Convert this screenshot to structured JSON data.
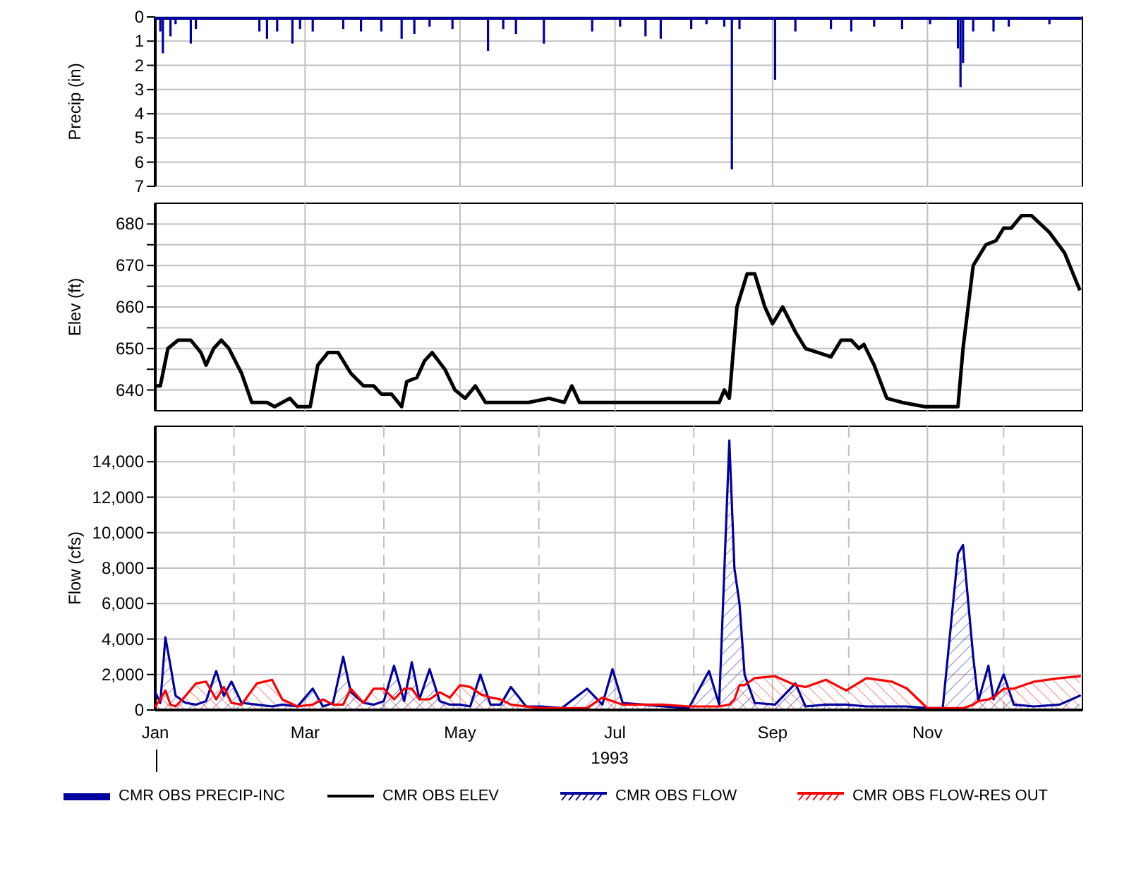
{
  "panels": [
    {
      "chart_data": {
        "type": "bar",
        "ylabel": "Precip (in)",
        "grid": true,
        "xlim": [
          "1993-01-01",
          "1994-01-01"
        ],
        "ylim": [
          7,
          0
        ],
        "yticks": [
          0,
          1,
          2,
          3,
          4,
          5,
          6,
          7
        ],
        "x": [
          "1993-01-03",
          "1993-01-04",
          "1993-01-07",
          "1993-01-09",
          "1993-01-15",
          "1993-01-17",
          "1993-02-11",
          "1993-02-14",
          "1993-02-18",
          "1993-02-24",
          "1993-02-27",
          "1993-03-04",
          "1993-03-16",
          "1993-03-23",
          "1993-03-31",
          "1993-04-08",
          "1993-04-13",
          "1993-04-19",
          "1993-04-28",
          "1993-05-12",
          "1993-05-18",
          "1993-05-23",
          "1993-06-03",
          "1993-06-22",
          "1993-07-03",
          "1993-07-13",
          "1993-07-19",
          "1993-07-31",
          "1993-08-06",
          "1993-08-13",
          "1993-08-16",
          "1993-08-19",
          "1993-09-02",
          "1993-09-10",
          "1993-09-24",
          "1993-10-02",
          "1993-10-11",
          "1993-10-22",
          "1993-11-02",
          "1993-11-13",
          "1993-11-14",
          "1993-11-15",
          "1993-11-19",
          "1993-11-27",
          "1993-12-03",
          "1993-12-19"
        ],
        "series": [
          {
            "name": "CMR OBS PRECIP-INC",
            "color": "#0000a0",
            "values": [
              0.6,
              1.5,
              0.8,
              0.3,
              1.1,
              0.5,
              0.6,
              0.9,
              0.6,
              1.1,
              0.5,
              0.6,
              0.5,
              0.6,
              0.6,
              0.9,
              0.7,
              0.4,
              0.5,
              1.4,
              0.5,
              0.7,
              1.1,
              0.6,
              0.4,
              0.8,
              0.9,
              0.5,
              0.3,
              0.4,
              6.3,
              0.5,
              2.6,
              0.6,
              0.5,
              0.6,
              0.4,
              0.5,
              0.3,
              1.3,
              2.9,
              1.9,
              0.6,
              0.6,
              0.4,
              0.3
            ]
          }
        ]
      }
    },
    {
      "chart_data": {
        "type": "line",
        "ylabel": "Elev (ft)",
        "grid": true,
        "xlim": [
          "1993-01-01",
          "1994-01-01"
        ],
        "ylim": [
          635,
          685
        ],
        "yticks": [
          640,
          650,
          660,
          670,
          680
        ],
        "x": [
          "1993-01-01",
          "1993-01-03",
          "1993-01-06",
          "1993-01-10",
          "1993-01-15",
          "1993-01-19",
          "1993-01-21",
          "1993-01-24",
          "1993-01-27",
          "1993-01-30",
          "1993-02-04",
          "1993-02-08",
          "1993-02-14",
          "1993-02-17",
          "1993-02-23",
          "1993-02-26",
          "1993-03-03",
          "1993-03-06",
          "1993-03-10",
          "1993-03-14",
          "1993-03-19",
          "1993-03-24",
          "1993-03-28",
          "1993-03-31",
          "1993-04-04",
          "1993-04-08",
          "1993-04-10",
          "1993-04-14",
          "1993-04-17",
          "1993-04-20",
          "1993-04-25",
          "1993-04-29",
          "1993-05-03",
          "1993-05-07",
          "1993-05-11",
          "1993-05-19",
          "1993-05-28",
          "1993-06-05",
          "1993-06-11",
          "1993-06-14",
          "1993-06-17",
          "1993-06-27",
          "1993-07-14",
          "1993-08-11",
          "1993-08-13",
          "1993-08-15",
          "1993-08-18",
          "1993-08-22",
          "1993-08-25",
          "1993-08-29",
          "1993-09-01",
          "1993-09-05",
          "1993-09-10",
          "1993-09-14",
          "1993-09-19",
          "1993-09-24",
          "1993-09-28",
          "1993-10-02",
          "1993-10-05",
          "1993-10-07",
          "1993-10-11",
          "1993-10-16",
          "1993-10-22",
          "1993-10-31",
          "1993-11-13",
          "1993-11-15",
          "1993-11-19",
          "1993-11-24",
          "1993-11-28",
          "1993-12-01",
          "1993-12-04",
          "1993-12-08",
          "1993-12-12",
          "1993-12-19",
          "1993-12-25",
          "1993-12-31"
        ],
        "series": [
          {
            "name": "CMR OBS ELEV",
            "color": "#000000",
            "values": [
              641,
              641,
              650,
              652,
              652,
              649,
              646,
              650,
              652,
              650,
              644,
              637,
              637,
              636,
              638,
              636,
              636,
              646,
              649,
              649,
              644,
              641,
              641,
              639,
              639,
              636,
              642,
              643,
              647,
              649,
              645,
              640,
              638,
              641,
              637,
              637,
              637,
              638,
              637,
              641,
              637,
              637,
              637,
              637,
              640,
              638,
              660,
              668,
              668,
              660,
              656,
              660,
              654,
              650,
              649,
              648,
              652,
              652,
              650,
              651,
              646,
              638,
              637,
              636,
              636,
              650,
              670,
              675,
              676,
              679,
              679,
              682,
              682,
              678,
              673,
              664
            ]
          }
        ]
      }
    },
    {
      "chart_data": {
        "type": "area",
        "ylabel": "Flow (cfs)",
        "grid": true,
        "xlabel": "1993",
        "xlim": [
          "1993-01-01",
          "1994-01-01"
        ],
        "ylim": [
          0,
          16000
        ],
        "yticks": [
          {
            "value": 0,
            "label": "0"
          },
          {
            "value": 2000,
            "label": "2,000"
          },
          {
            "value": 4000,
            "label": "4,000"
          },
          {
            "value": 6000,
            "label": "6,000"
          },
          {
            "value": 8000,
            "label": "8,000"
          },
          {
            "value": 10000,
            "label": "10,000"
          },
          {
            "value": 12000,
            "label": "12,000"
          },
          {
            "value": 14000,
            "label": "14,000"
          }
        ],
        "xticks": [
          {
            "value": "1993-01-01",
            "label": "Jan"
          },
          {
            "value": "1993-03-01",
            "label": "Mar"
          },
          {
            "value": "1993-05-01",
            "label": "May"
          },
          {
            "value": "1993-07-01",
            "label": "Jul"
          },
          {
            "value": "1993-09-01",
            "label": "Sep"
          },
          {
            "value": "1993-11-01",
            "label": "Nov"
          }
        ],
        "x": [
          "1993-01-01",
          "1993-01-03",
          "1993-01-05",
          "1993-01-07",
          "1993-01-09",
          "1993-01-13",
          "1993-01-17",
          "1993-01-21",
          "1993-01-25",
          "1993-01-28",
          "1993-01-31",
          "1993-02-04",
          "1993-02-10",
          "1993-02-16",
          "1993-02-20",
          "1993-02-26",
          "1993-03-04",
          "1993-03-08",
          "1993-03-12",
          "1993-03-16",
          "1993-03-19",
          "1993-03-24",
          "1993-03-28",
          "1993-04-01",
          "1993-04-05",
          "1993-04-09",
          "1993-04-12",
          "1993-04-15",
          "1993-04-19",
          "1993-04-23",
          "1993-04-27",
          "1993-05-01",
          "1993-05-05",
          "1993-05-09",
          "1993-05-13",
          "1993-05-17",
          "1993-05-21",
          "1993-05-27",
          "1993-06-02",
          "1993-06-10",
          "1993-06-20",
          "1993-06-26",
          "1993-06-30",
          "1993-07-04",
          "1993-07-12",
          "1993-07-20",
          "1993-07-30",
          "1993-08-07",
          "1993-08-11",
          "1993-08-15",
          "1993-08-17",
          "1993-08-19",
          "1993-08-21",
          "1993-08-25",
          "1993-09-02",
          "1993-09-10",
          "1993-09-14",
          "1993-09-22",
          "1993-09-30",
          "1993-10-08",
          "1993-10-18",
          "1993-10-24",
          "1993-11-01",
          "1993-11-07",
          "1993-11-13",
          "1993-11-15",
          "1993-11-19",
          "1993-11-21",
          "1993-11-25",
          "1993-11-27",
          "1993-12-01",
          "1993-12-05",
          "1993-12-13",
          "1993-12-23",
          "1993-12-31"
        ],
        "series": [
          {
            "name": "CMR OBS FLOW",
            "color": "#0000a0",
            "values": [
              1000,
              400,
              4100,
              2500,
              800,
              400,
              300,
              500,
              2200,
              800,
              1600,
              400,
              300,
              200,
              300,
              200,
              1200,
              200,
              400,
              3000,
              1000,
              400,
              300,
              500,
              2500,
              500,
              2700,
              600,
              2300,
              500,
              300,
              300,
              200,
              2000,
              300,
              300,
              1300,
              200,
              200,
              100,
              1200,
              300,
              2300,
              400,
              300,
              200,
              100,
              2200,
              300,
              15200,
              8000,
              6000,
              2000,
              400,
              300,
              1500,
              200,
              300,
              300,
              200,
              200,
              200,
              100,
              100,
              8800,
              9300,
              3000,
              500,
              2500,
              600,
              2000,
              300,
              200,
              300,
              800
            ]
          },
          {
            "name": "CMR OBS FLOW-RES OUT",
            "color": "#ff0000",
            "values": [
              200,
              600,
              1100,
              300,
              200,
              800,
              1500,
              1600,
              600,
              1300,
              400,
              300,
              1500,
              1700,
              600,
              200,
              300,
              600,
              300,
              300,
              1200,
              400,
              1200,
              1200,
              600,
              1200,
              1200,
              600,
              600,
              1000,
              700,
              1400,
              1300,
              900,
              700,
              600,
              300,
              200,
              100,
              100,
              100,
              700,
              500,
              300,
              300,
              300,
              200,
              200,
              200,
              300,
              600,
              1400,
              1400,
              1800,
              1900,
              1400,
              1300,
              1700,
              1100,
              1800,
              1600,
              1200,
              100,
              100,
              100,
              100,
              300,
              500,
              600,
              700,
              1200,
              1200,
              1600,
              1800,
              1900
            ]
          }
        ]
      }
    }
  ]
}
